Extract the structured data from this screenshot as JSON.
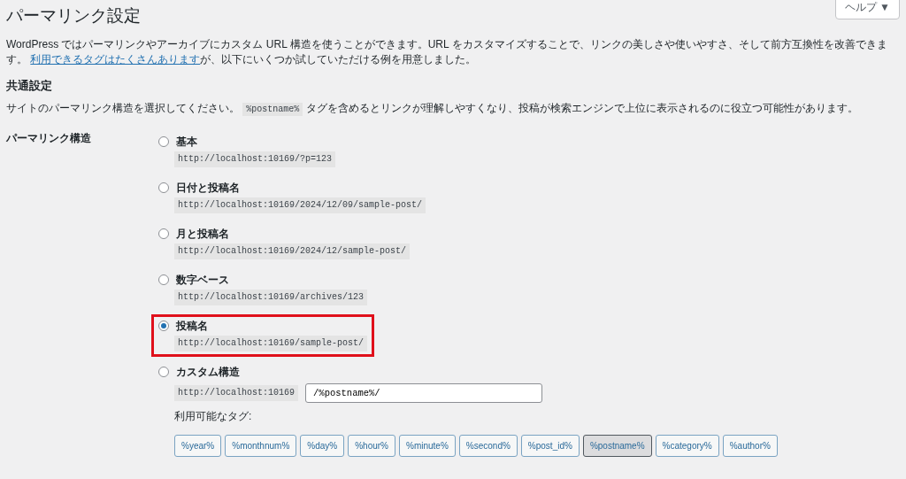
{
  "page_title": "パーマリンク設定",
  "help_button": {
    "label": "ヘルプ",
    "caret": "▼"
  },
  "intro": {
    "text": "WordPress ではパーマリンクやアーカイブにカスタム URL 構造を使うことができます。URL をカスタマイズすることで、リンクの美しさや使いやすさ、そして前方互換性を改善できます。",
    "link": "利用できるタグはたくさんあります",
    "after": "が、以下にいくつか試していただける例を用意しました。"
  },
  "section_title": "共通設定",
  "section_desc": {
    "before": "サイトのパーマリンク構造を選択してください。",
    "code": "%postname%",
    "after": "タグを含めるとリンクが理解しやすくなり、投稿が検索エンジンで上位に表示されるのに役立つ可能性があります。"
  },
  "field_label": "パーマリンク構造",
  "options": [
    {
      "kind": "preset",
      "label": "基本",
      "example": "http://localhost:10169/?p=123",
      "selected": false,
      "highlighted": false
    },
    {
      "kind": "preset",
      "label": "日付と投稿名",
      "example": "http://localhost:10169/2024/12/09/sample-post/",
      "selected": false,
      "highlighted": false
    },
    {
      "kind": "preset",
      "label": "月と投稿名",
      "example": "http://localhost:10169/2024/12/sample-post/",
      "selected": false,
      "highlighted": false
    },
    {
      "kind": "preset",
      "label": "数字ベース",
      "example": "http://localhost:10169/archives/123",
      "selected": false,
      "highlighted": false
    },
    {
      "kind": "preset",
      "label": "投稿名",
      "example": "http://localhost:10169/sample-post/",
      "selected": true,
      "highlighted": true
    },
    {
      "kind": "custom",
      "label": "カスタム構造",
      "example": "http://localhost:10169",
      "value": "/%postname%/",
      "selected": false,
      "highlighted": false
    }
  ],
  "tags_label": "利用可能なタグ:",
  "tags": [
    {
      "label": "%year%",
      "selected": false
    },
    {
      "label": "%monthnum%",
      "selected": false
    },
    {
      "label": "%day%",
      "selected": false
    },
    {
      "label": "%hour%",
      "selected": false
    },
    {
      "label": "%minute%",
      "selected": false
    },
    {
      "label": "%second%",
      "selected": false
    },
    {
      "label": "%post_id%",
      "selected": false
    },
    {
      "label": "%postname%",
      "selected": true
    },
    {
      "label": "%category%",
      "selected": false
    },
    {
      "label": "%author%",
      "selected": false
    }
  ]
}
